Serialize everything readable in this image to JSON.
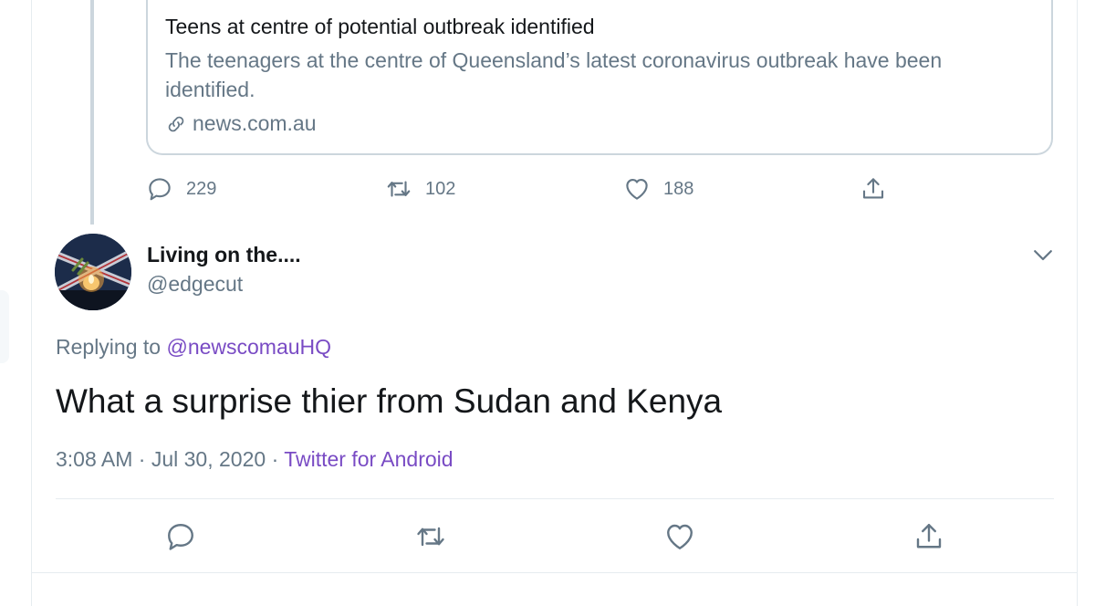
{
  "quoted_card": {
    "title": "Teens at centre of potential outbreak identified",
    "description": "The teenagers at the centre of Queensland’s latest coronavirus outbreak have been identified.",
    "domain": "news.com.au",
    "link_icon": "link-icon"
  },
  "parent_actions": {
    "replies": "229",
    "retweets": "102",
    "likes": "188",
    "share_icon": "share-icon"
  },
  "tweet": {
    "display_name": "Living on the....",
    "handle": "@edgecut",
    "replying_prefix": "Replying to",
    "replying_to": "@newscomauHQ",
    "text": "What a surprise thier from Sudan and Kenya",
    "time": "3:08 AM",
    "separator": "·",
    "date": "Jul 30, 2020",
    "source": "Twitter for Android"
  },
  "icons": [
    "reply-icon",
    "retweet-icon",
    "like-icon",
    "share-icon",
    "chevron-down-icon"
  ],
  "colors": {
    "text": "#14171a",
    "muted": "#657786",
    "accent": "#794bc4",
    "border": "#ccd6dd"
  }
}
